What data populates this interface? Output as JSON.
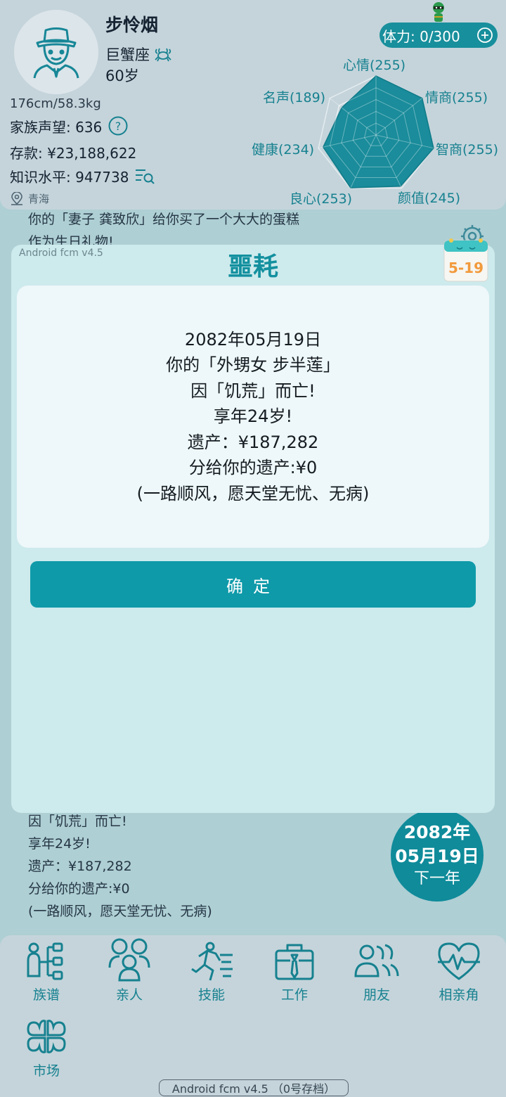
{
  "profile": {
    "name": "步怜烟",
    "zodiac": "巨蟹座",
    "age": "60岁",
    "body": "176cm/58.3kg",
    "family_reputation": "家族声望: 636",
    "savings": "存款: ¥23,188,622",
    "knowledge": "知识水平: 947738",
    "location": "青海",
    "stamina": "体力: 0/300"
  },
  "radar": {
    "labels": {
      "mood": "心情(255)",
      "eq": "情商(255)",
      "iq": "智商(255)",
      "looks": "颜值(245)",
      "conscience": "良心(253)",
      "health": "健康(234)",
      "fame": "名声(189)"
    },
    "values": [
      255,
      255,
      255,
      245,
      253,
      234,
      189
    ],
    "max": 255,
    "fill_color": "#1a8c9b"
  },
  "log_top": {
    "line1": "你的「妻子 龚致欣」给你买了一个大大的蛋糕",
    "line2": "作为生日礼物!"
  },
  "log_bottom": {
    "line1": "因「饥荒」而亡!",
    "line2": "享年24岁!",
    "line3": "遗产：¥187,282",
    "line4": "分给你的遗产:¥0",
    "line5": "(一路顺风，愿天堂无忧、无病)"
  },
  "date_badge": {
    "year": "2082年",
    "day": "05月19日",
    "next": "下一年"
  },
  "nav": {
    "genealogy": "族谱",
    "relatives": "亲人",
    "skills": "技能",
    "work": "工作",
    "friends": "朋友",
    "dating": "相亲角",
    "market": "市场"
  },
  "footer_version": "Android fcm v4.5  （0号存档）",
  "modal": {
    "version": "Android fcm v4.5",
    "title": "噩耗",
    "calendar_date": "5-19",
    "message": {
      "date": "2082年05月19日",
      "who": "你的「外甥女 步半莲」",
      "cause": "因「饥荒」而亡!",
      "age": "享年24岁!",
      "estate": "遗产：¥187,282",
      "share": "分给你的遗产:¥0",
      "blessing": "(一路顺风，愿天堂无忧、无病)"
    },
    "confirm": "确定"
  },
  "colors": {
    "accent": "#0e9aa9",
    "teal_text": "#16818f",
    "modal_bg": "#cdeaed",
    "message_bg": "#eef7f9",
    "page_bg": "#aecfd4"
  }
}
